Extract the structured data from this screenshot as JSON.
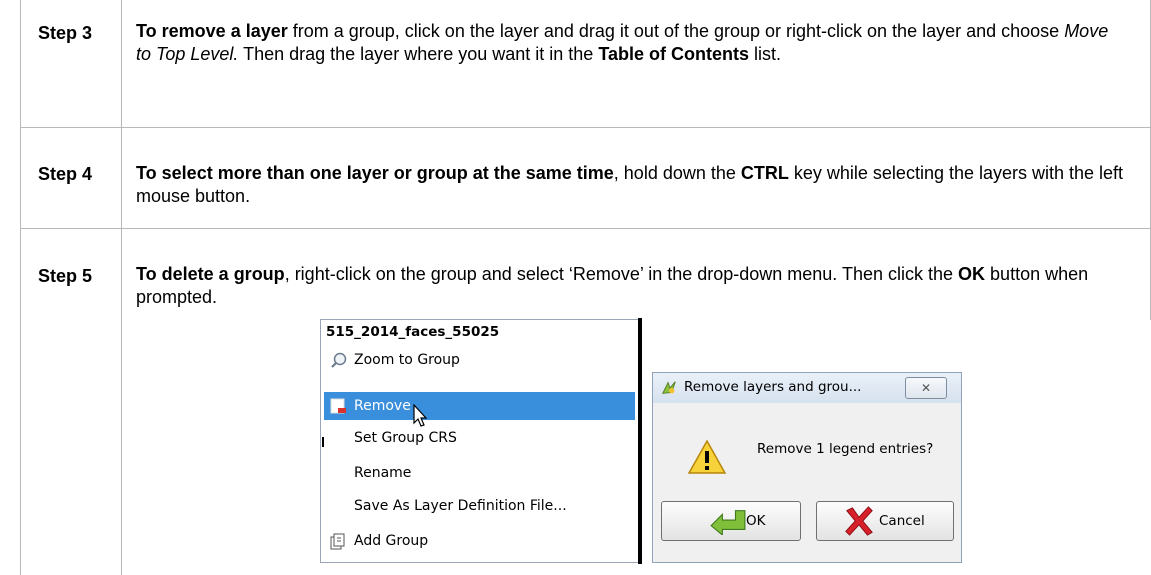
{
  "steps": [
    {
      "label": "Step 3",
      "strong": "To remove a layer",
      "t1": " from a group, click on the layer and drag it out of the group or right-click on the layer and choose ",
      "em": "Move to Top Level.",
      "t2": " Then drag the layer where you want it in the ",
      "strong2": "Table of Contents",
      "t3": " list."
    },
    {
      "label": "Step 4",
      "strong": "To select more than one layer or group at the same time",
      "t1": ", hold down the ",
      "strong2": "CTRL",
      "t2": " key while selecting the layers with the left mouse button."
    },
    {
      "label": "Step 5",
      "strong": "To delete a group",
      "t1": ", right-click on the group and select ‘Remove’ in the drop-down menu. Then click the ",
      "strong2": "OK",
      "t2": " button when prompted."
    }
  ],
  "context_menu": {
    "title": "515_2014_faces_55025",
    "items": [
      {
        "label": "Zoom to Group",
        "icon": "magnifier-icon"
      },
      {
        "label": "Remove",
        "icon": "remove-layer-icon",
        "selected": true
      },
      {
        "label": "Set Group CRS",
        "icon": ""
      },
      {
        "label": "Rename",
        "icon": ""
      },
      {
        "label": "Save As Layer Definition File...",
        "icon": ""
      },
      {
        "label": "Add Group",
        "icon": "add-group-icon"
      }
    ]
  },
  "dialog": {
    "title": "Remove layers and grou...",
    "close_glyph": "✕",
    "message": "Remove 1 legend entries?",
    "ok_label": "OK",
    "cancel_label": "Cancel",
    "icons": [
      "qgis-icon",
      "warning-icon",
      "ok-arrow-icon",
      "cancel-x-icon"
    ]
  }
}
